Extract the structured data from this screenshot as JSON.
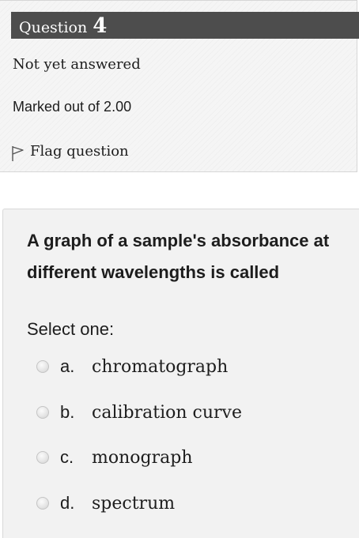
{
  "info": {
    "question_label": "Question",
    "question_number": "4",
    "status": "Not yet answered",
    "marks": "Marked out of 2.00",
    "flag_label": "Flag question"
  },
  "question": {
    "text": "A graph of a sample's absorbance at different wavelengths is called",
    "prompt": "Select one:",
    "options": [
      {
        "letter": "a.",
        "text": "chromatograph"
      },
      {
        "letter": "b.",
        "text": "calibration curve"
      },
      {
        "letter": "c.",
        "text": "monograph"
      },
      {
        "letter": "d.",
        "text": "spectrum"
      }
    ]
  },
  "colors": {
    "header_bar": "#4d4d4d",
    "panel_bg": "#f2f2f2"
  },
  "icons": {
    "flag": "flag-outline-icon",
    "radio": "radio-unselected-icon"
  }
}
